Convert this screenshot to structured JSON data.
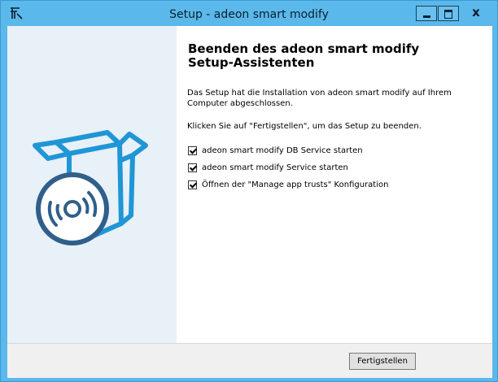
{
  "window": {
    "title": "Setup - adeon smart modify",
    "accent_color": "#5bb8ea",
    "icon": "installer-app-icon"
  },
  "titlebar_buttons": [
    "minimize-icon",
    "maximize-icon",
    "close-icon"
  ],
  "close_glyph": "x",
  "sidebar": {
    "image": "box-with-disc-icon",
    "background": "#e8f0f8"
  },
  "content": {
    "heading_line1": "Beenden des adeon smart modify",
    "heading_line2": "Setup-Assistenten",
    "paragraph1": "Das Setup hat die Installation von adeon smart modify auf Ihrem Computer abgeschlossen.",
    "paragraph2": "Klicken Sie auf \"Fertigstellen\", um das Setup zu beenden."
  },
  "options": [
    {
      "label": "adeon smart modify DB Service starten",
      "checked": true
    },
    {
      "label": "adeon smart modify Service starten",
      "checked": true
    },
    {
      "label": "Öffnen der \"Manage app trusts\" Konfiguration",
      "checked": true
    }
  ],
  "footer": {
    "finish_label": "Fertigstellen"
  }
}
